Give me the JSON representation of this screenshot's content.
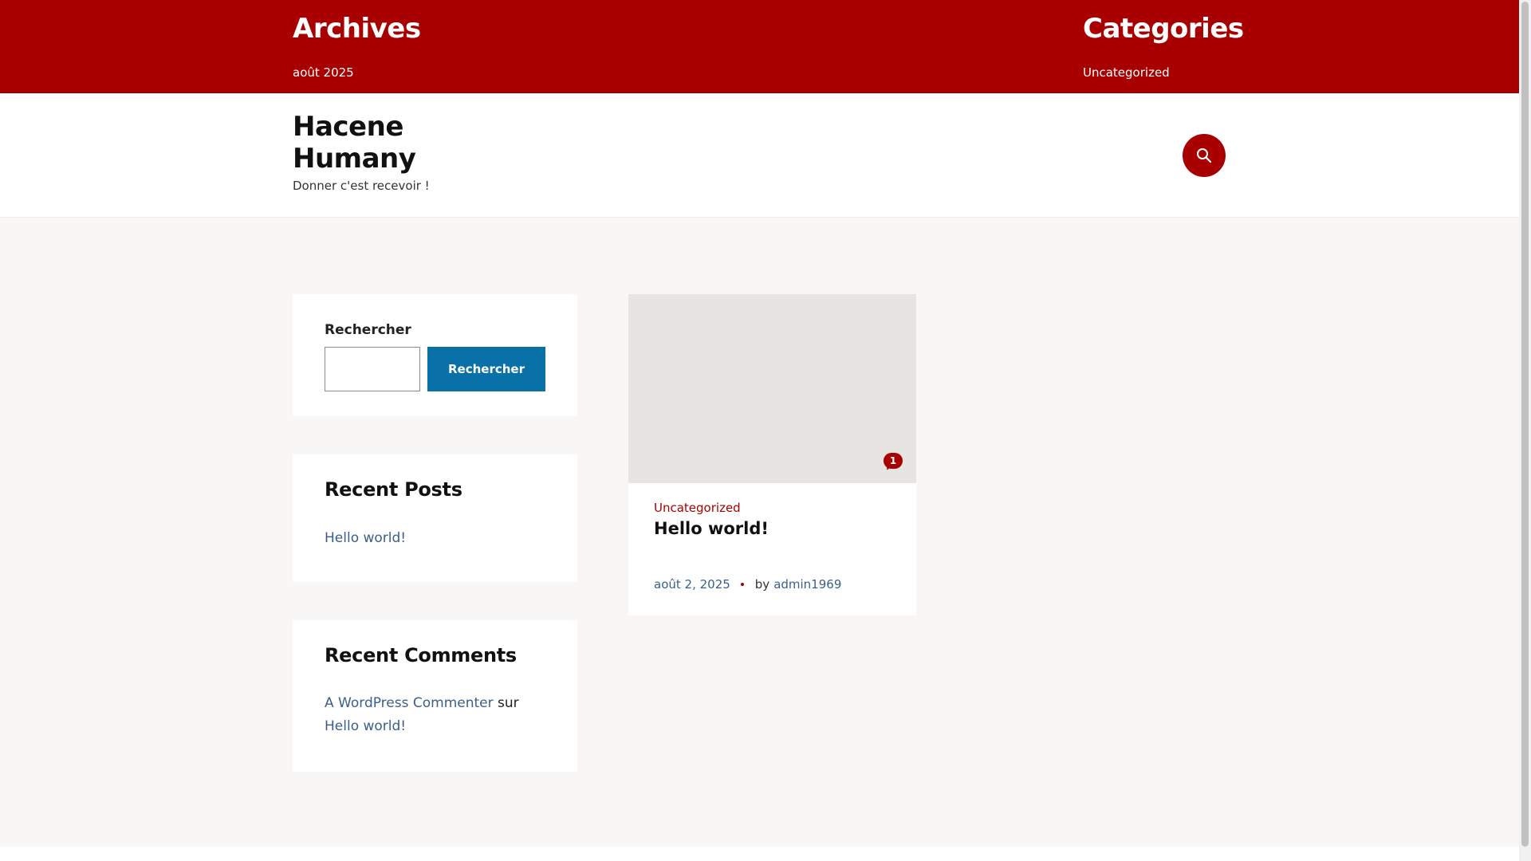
{
  "topbar": {
    "archives": {
      "title": "Archives",
      "link": "août 2025"
    },
    "categories": {
      "title": "Categories",
      "link": "Uncategorized"
    },
    "bg_color": "#a80000"
  },
  "header": {
    "site_title": "Hacene Humany",
    "tagline": "Donner c'est recevoir !",
    "search_icon": "search-icon"
  },
  "sidebar": {
    "search": {
      "label": "Rechercher",
      "input_value": "",
      "button_label": "Rechercher"
    },
    "recent_posts": {
      "title": "Recent Posts",
      "items": [
        "Hello world!"
      ]
    },
    "recent_comments": {
      "title": "Recent Comments",
      "author": "A WordPress Commenter",
      "connector": "sur",
      "post": "Hello world!"
    }
  },
  "post": {
    "category": "Uncategorized",
    "title": "Hello world!",
    "comment_count": "1",
    "date": "août 2, 2025",
    "by": "by",
    "author": "admin1969"
  },
  "colors": {
    "accent": "#a80000",
    "button": "#0a70a8",
    "link": "#3b5f8a"
  }
}
